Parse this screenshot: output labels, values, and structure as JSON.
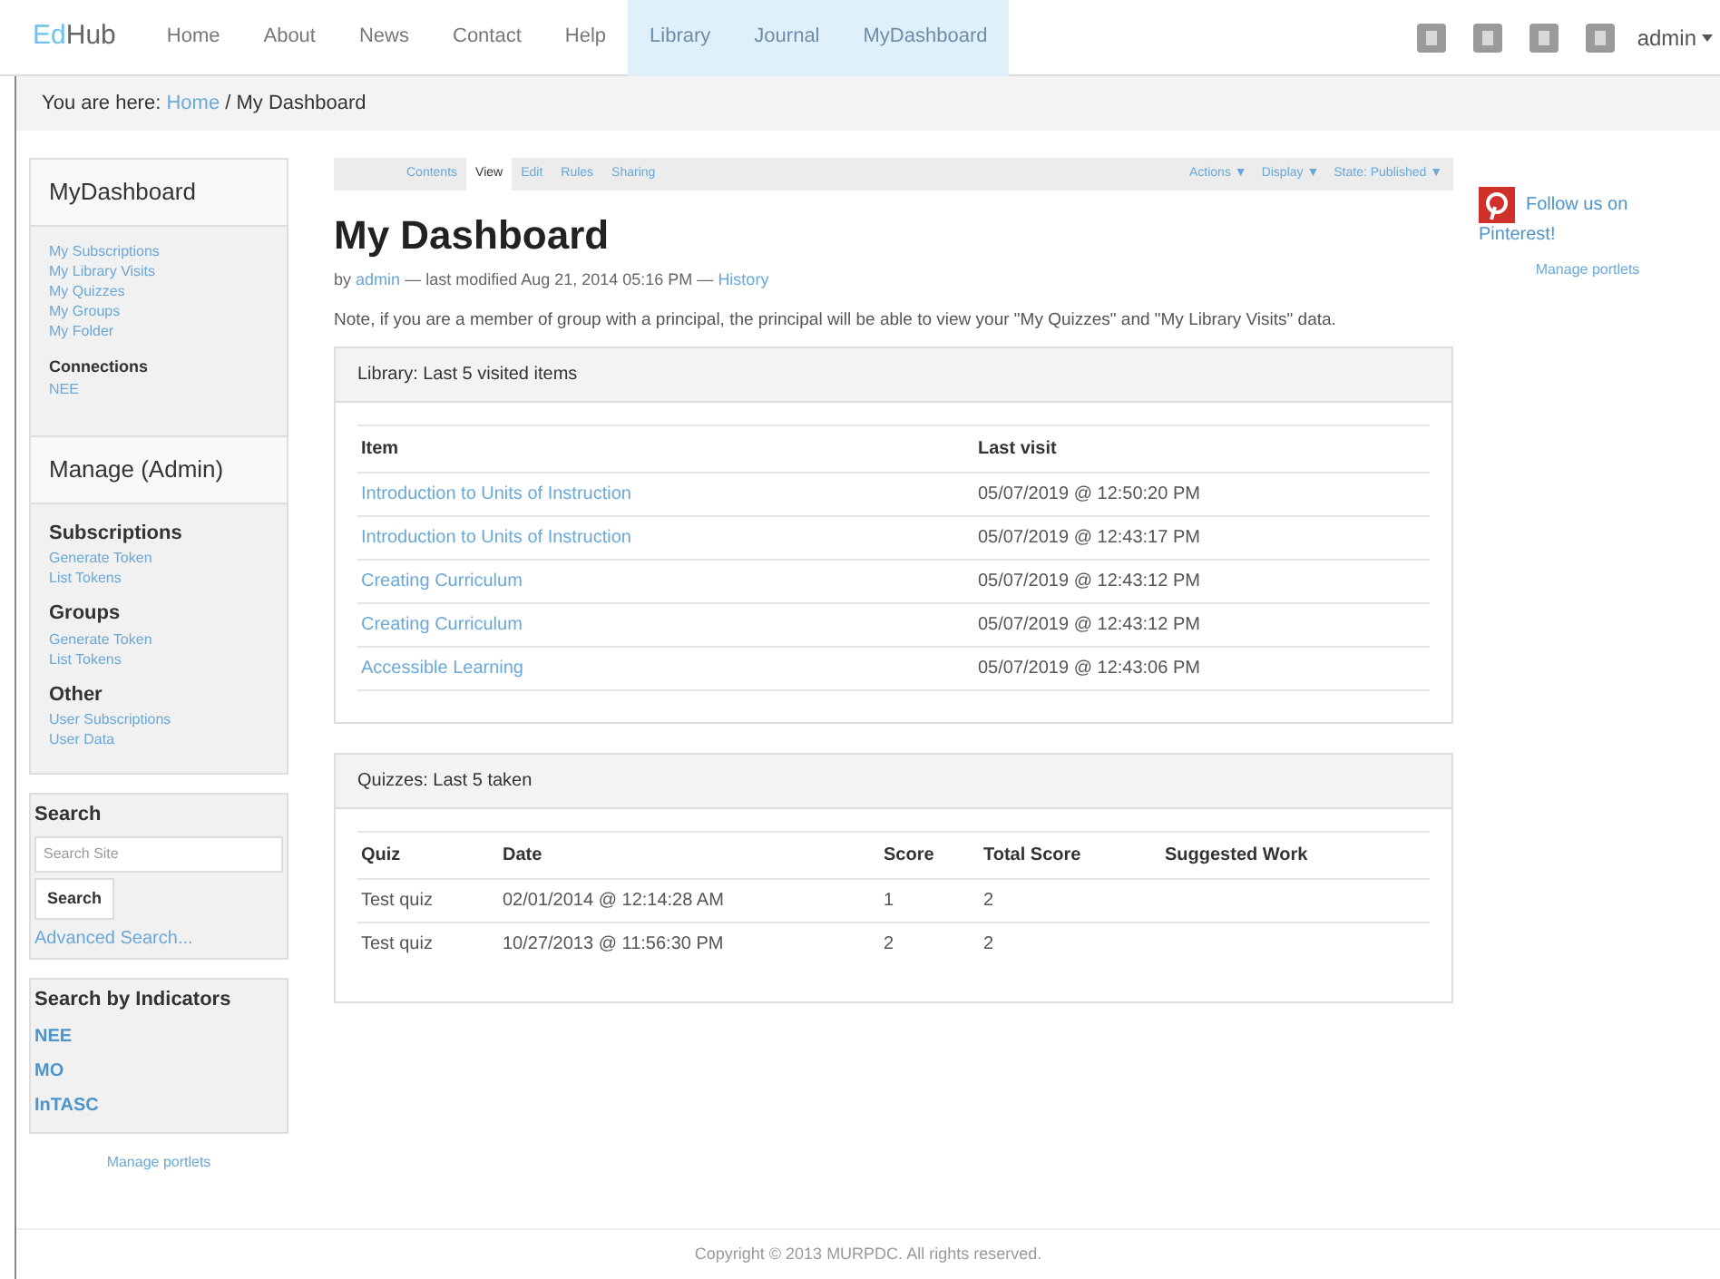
{
  "logo": {
    "accent": "Ed",
    "rest": "Hub"
  },
  "nav": [
    {
      "label": "Home",
      "highlighted": false
    },
    {
      "label": "About",
      "highlighted": false
    },
    {
      "label": "News",
      "highlighted": false
    },
    {
      "label": "Contact",
      "highlighted": false
    },
    {
      "label": "Help",
      "highlighted": false
    },
    {
      "label": "Library",
      "highlighted": true
    },
    {
      "label": "Journal",
      "highlighted": true
    },
    {
      "label": "MyDashboard",
      "highlighted": true
    }
  ],
  "user_menu": "admin",
  "breadcrumb": {
    "prefix": "You are here:",
    "link": "Home",
    "current": "/ My Dashboard"
  },
  "left": {
    "dashboard_title": "MyDashboard",
    "dashboard_links": [
      "My Subscriptions",
      "My Library Visits",
      "My Quizzes",
      "My Groups",
      "My Folder"
    ],
    "connections_title": "Connections",
    "connections_links": [
      "NEE"
    ],
    "manage_title": "Manage (Admin)",
    "manage_sections": [
      {
        "title": "Subscriptions",
        "links": [
          "Generate Token",
          "List Tokens"
        ]
      },
      {
        "title": "Groups",
        "links": [
          "Generate Token",
          "List Tokens"
        ]
      },
      {
        "title": "Other",
        "links": [
          "User Subscriptions",
          "User Data"
        ]
      }
    ],
    "search": {
      "title": "Search",
      "placeholder": "Search Site",
      "button": "Search",
      "advanced": "Advanced Search..."
    },
    "indicators": {
      "title": "Search by Indicators",
      "links": [
        "NEE",
        "MO",
        "InTASC"
      ]
    },
    "manage_portlets": "Manage portlets"
  },
  "edit_bar": {
    "tabs": [
      {
        "label": "Contents",
        "selected": false
      },
      {
        "label": "View",
        "selected": true
      },
      {
        "label": "Edit",
        "selected": false
      },
      {
        "label": "Rules",
        "selected": false
      },
      {
        "label": "Sharing",
        "selected": false
      }
    ],
    "menus": [
      "Actions ▼",
      "Display ▼",
      "State: Published ▼"
    ]
  },
  "page": {
    "title": "My Dashboard",
    "byline": {
      "prefix": "by",
      "author": "admin",
      "middle": "— last modified Aug 21, 2014 05:16 PM —",
      "history": "History"
    },
    "note": "Note, if you are a member of group with a principal, the principal will be able to view your \"My Quizzes\" and \"My Library Visits\" data."
  },
  "library": {
    "title": "Library: Last 5 visited items",
    "columns": [
      "Item",
      "Last visit"
    ],
    "rows": [
      [
        "Introduction to Units of Instruction",
        "05/07/2019 @ 12:50:20 PM"
      ],
      [
        "Introduction to Units of Instruction",
        "05/07/2019 @ 12:43:17 PM"
      ],
      [
        "Creating Curriculum",
        "05/07/2019 @ 12:43:12 PM"
      ],
      [
        "Creating Curriculum",
        "05/07/2019 @ 12:43:12 PM"
      ],
      [
        "Accessible Learning",
        "05/07/2019 @ 12:43:06 PM"
      ]
    ]
  },
  "quizzes": {
    "title": "Quizzes: Last 5 taken",
    "columns": [
      "Quiz",
      "Date",
      "Score",
      "Total Score",
      "Suggested Work"
    ],
    "rows": [
      [
        "Test quiz",
        "02/01/2014 @ 12:14:28 AM",
        "1",
        "2"
      ],
      [
        "Test quiz",
        "10/27/2013 @ 11:56:30 PM",
        "2",
        "2"
      ]
    ]
  },
  "right": {
    "follow": "Follow us on Pinterest!",
    "manage_portlets": "Manage portlets"
  },
  "footer": "Copyright © 2013 MURPDC. All rights reserved."
}
